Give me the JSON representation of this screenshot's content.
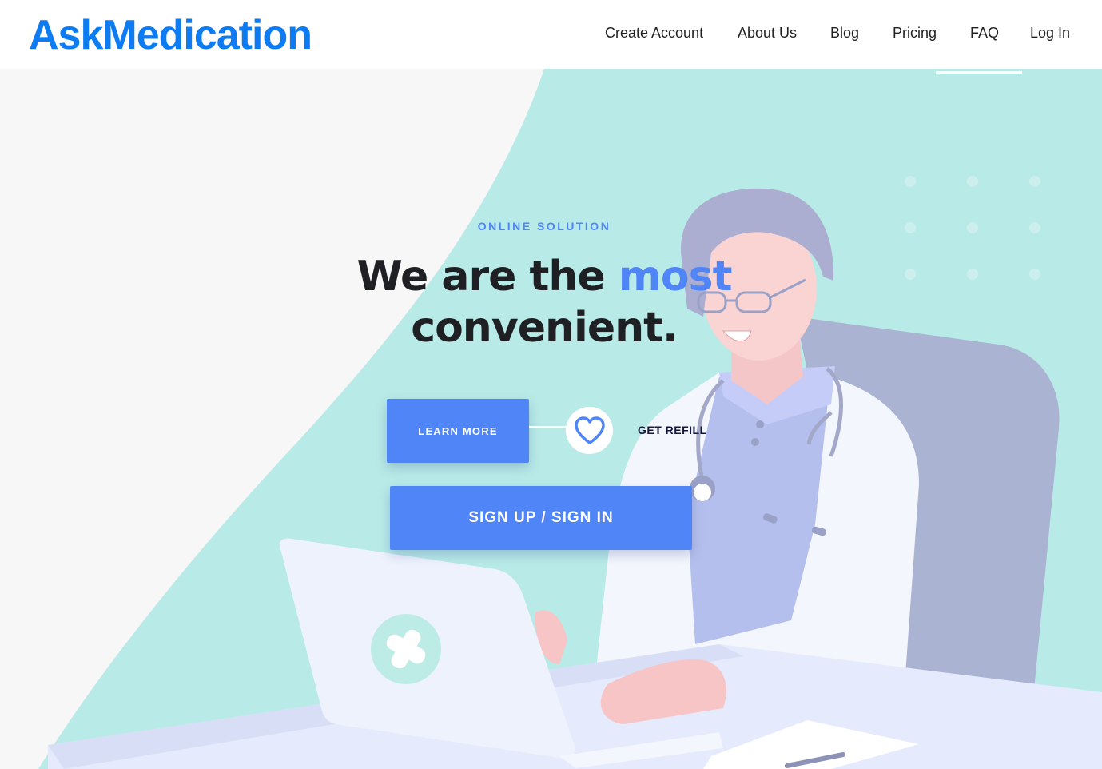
{
  "header": {
    "brand": "AskMedication",
    "nav": [
      {
        "label": "Create Account"
      },
      {
        "label": "About Us"
      },
      {
        "label": "Blog"
      },
      {
        "label": "Pricing"
      },
      {
        "label": "FAQ"
      },
      {
        "label": "Log In"
      }
    ]
  },
  "hero": {
    "eyebrow": "ONLINE SOLUTION",
    "headline_part1": "We are the ",
    "headline_accent": "most",
    "headline_part2": "convenient.",
    "learn_more_label": "LEARN MORE",
    "refill_label": "GET REFILL",
    "signup_label": "SIGN UP / SIGN IN",
    "heart_icon": "heart-icon"
  },
  "colors": {
    "brand": "#0d7cf2",
    "accent": "#4f85f7",
    "hero_teal": "#b8eae7",
    "hero_gray": "#f7f7f7"
  }
}
